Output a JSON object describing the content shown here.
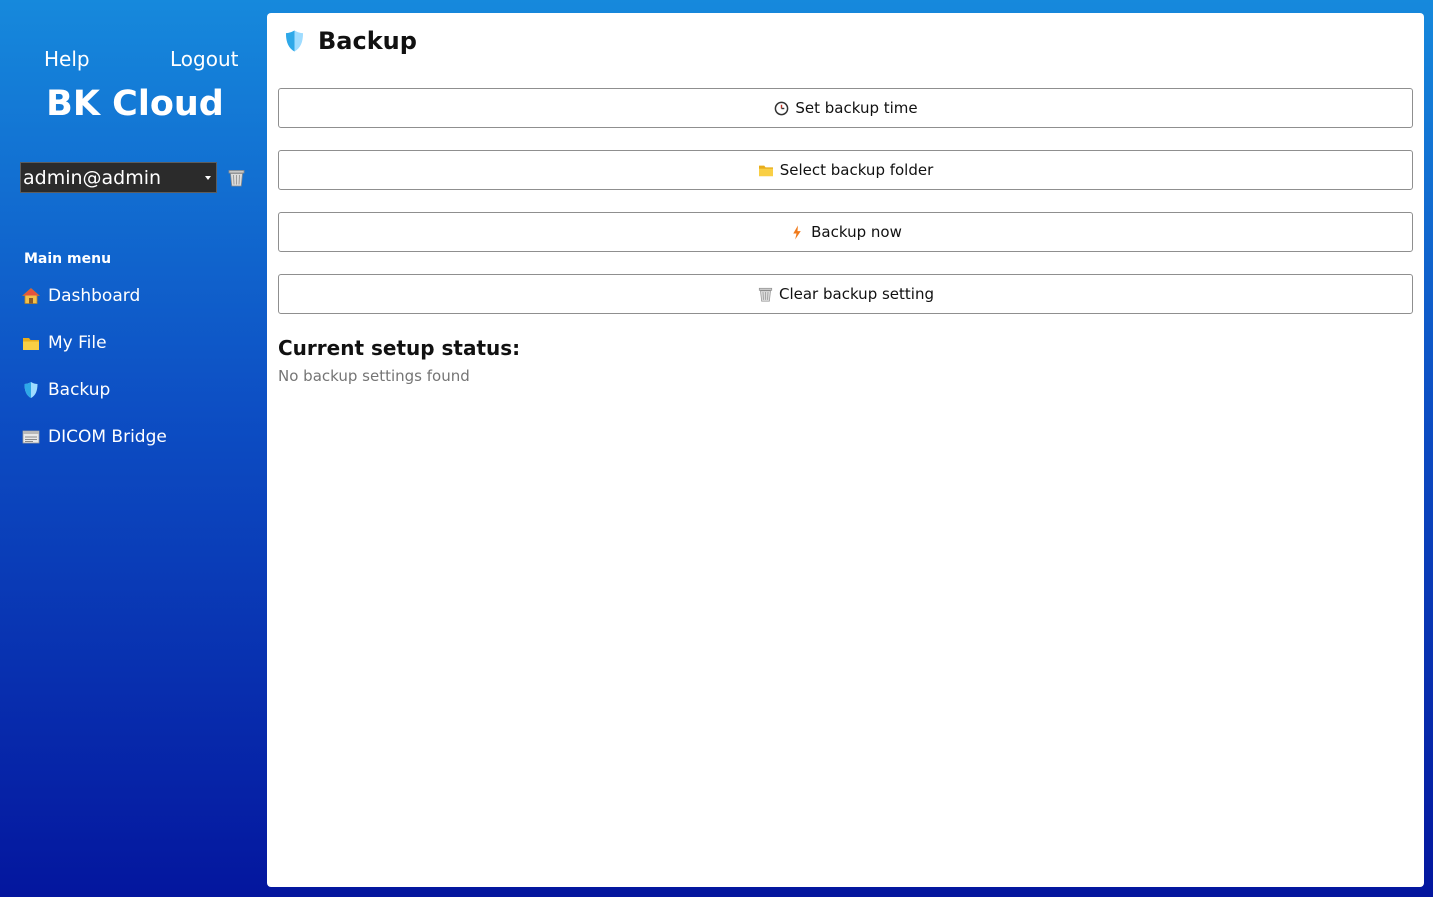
{
  "sidebar": {
    "help_label": "Help",
    "logout_label": "Logout",
    "app_title": "BK Cloud",
    "user_select": {
      "value": "admin@admin"
    },
    "menu_heading": "Main menu",
    "items": [
      {
        "label": "Dashboard",
        "icon": "house-icon"
      },
      {
        "label": "My File",
        "icon": "folder-icon"
      },
      {
        "label": "Backup",
        "icon": "shield-icon"
      },
      {
        "label": "DICOM Bridge",
        "icon": "bridge-card-icon"
      }
    ]
  },
  "main": {
    "title": "Backup",
    "title_icon": "shield-icon",
    "buttons": [
      {
        "label": "Set backup time",
        "icon": "clock-icon"
      },
      {
        "label": "Select backup folder",
        "icon": "folder-icon"
      },
      {
        "label": "Backup now",
        "icon": "lightning-icon"
      },
      {
        "label": "Clear backup setting",
        "icon": "trash-icon"
      }
    ],
    "status_heading": "Current setup status:",
    "status_text": "No backup settings found"
  },
  "colors": {
    "gradient_top": "#1689dc",
    "gradient_bottom": "#04169e",
    "shield": "#2ea8e8",
    "folder": "#f5c02b",
    "lightning": "#f07a1a",
    "status_text": "#757575"
  }
}
